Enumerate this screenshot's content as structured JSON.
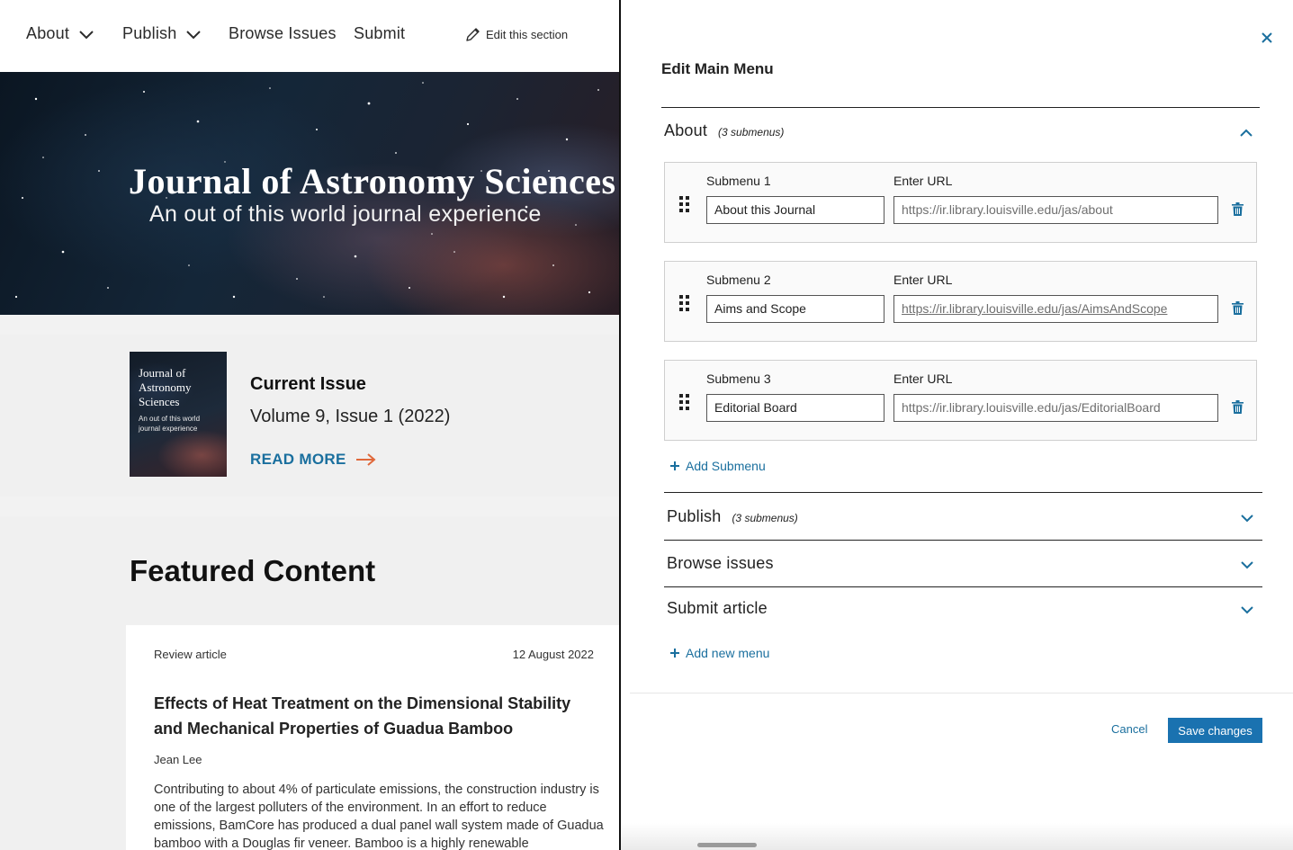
{
  "site": {
    "nav": {
      "about": "About",
      "publish": "Publish",
      "browse": "Browse Issues",
      "submit": "Submit",
      "edit_section": "Edit this section"
    },
    "hero": {
      "title": "Journal of Astronomy Sciences",
      "subtitle": "An out of this world journal experience"
    },
    "current_issue": {
      "cover_title": "Journal of Astronomy Sciences",
      "cover_subtitle": "An out of this world journal experience",
      "heading": "Current Issue",
      "volume": "Volume 9, Issue 1 (2022)",
      "read_more": "READ MORE"
    },
    "featured": {
      "heading": "Featured Content",
      "article": {
        "type": "Review article",
        "date": "12 August 2022",
        "title": "Effects of Heat Treatment on the Dimensional Stability and Mechanical Properties of Guadua Bamboo",
        "author": "Jean Lee",
        "abstract": "Contributing to about 4% of particulate emissions, the construction industry is one of the largest polluters of the environment. In an effort to reduce emissions, BamCore has produced a dual panel wall system made of Guadua bamboo with a Douglas fir veneer. Bamboo is a highly renewable"
      }
    }
  },
  "panel": {
    "title": "Edit Main Menu",
    "url_label": "Enter URL",
    "menus": [
      {
        "name": "About",
        "count": "(3 submenus)",
        "expanded": true,
        "submenus": [
          {
            "label": "Submenu 1",
            "value": "About this Journal",
            "url": "https://ir.library.louisville.edu/jas/about"
          },
          {
            "label": "Submenu 2",
            "value": "Aims and Scope",
            "url": "https://ir.library.louisville.edu/jas/AimsAndScope"
          },
          {
            "label": "Submenu 3",
            "value": "Editorial Board",
            "url": "https://ir.library.louisville.edu/jas/EditorialBoard"
          }
        ],
        "add_submenu": "Add Submenu"
      },
      {
        "name": "Publish",
        "count": "(3 submenus)",
        "expanded": false
      },
      {
        "name": "Browse issues",
        "expanded": false
      },
      {
        "name": "Submit article",
        "expanded": false
      }
    ],
    "add_menu": "Add new menu",
    "cancel": "Cancel",
    "save": "Save changes"
  },
  "colors": {
    "accent": "#1a6f9e",
    "primary_button": "#1a72b0",
    "read_more_arrow": "#e0683a"
  }
}
